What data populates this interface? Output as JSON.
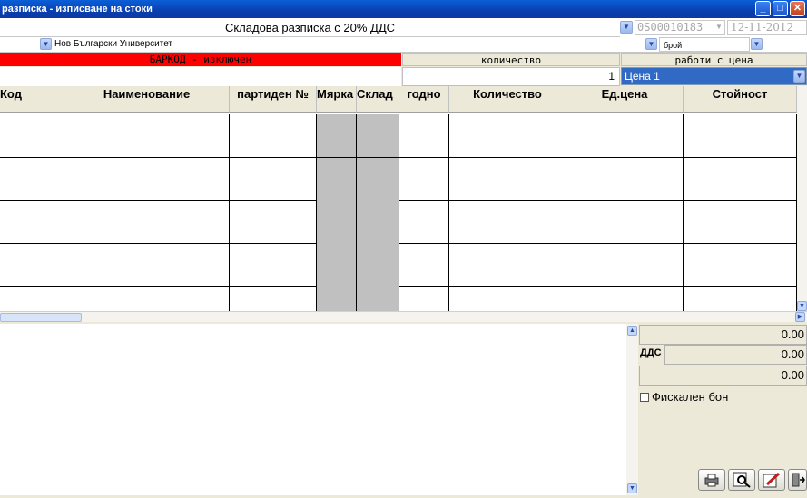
{
  "window": {
    "title": "разписка - изписване на стоки",
    "minimize_icon": "minimize-icon",
    "maximize_icon": "maximize-icon",
    "close_icon": "close-icon"
  },
  "header": {
    "document_type": "Складова разписка с 20% ДДС",
    "document_number": "0S00010183",
    "document_date": "12-11-2012",
    "client": "Нов Български Университет",
    "unit": "брой"
  },
  "entry": {
    "barcode_label": "БАРКОД - изключен",
    "quantity_label": "количество",
    "quantity_value": "1",
    "price_label": "работи с цена",
    "price_selected": "Цена 1"
  },
  "grid": {
    "columns": [
      "Код",
      "Наименование",
      "партиден №",
      "Мярка",
      "Склад",
      "годно",
      "Количество",
      "Ед.цена",
      "Стойност"
    ]
  },
  "totals": {
    "net": "0.00",
    "vat_label": "ДДС",
    "vat": "0.00",
    "total": "0.00",
    "fiscal_receipt_label": "Фискален бон"
  },
  "toolbar_icons": [
    "printer-icon",
    "preview-icon",
    "edit-icon",
    "exit-icon"
  ],
  "colors": {
    "title_bar": "#0a4fc8",
    "barcode_header": "#ff0000",
    "selected_price": "#316ac5",
    "disabled_column": "#c0c0c0"
  }
}
